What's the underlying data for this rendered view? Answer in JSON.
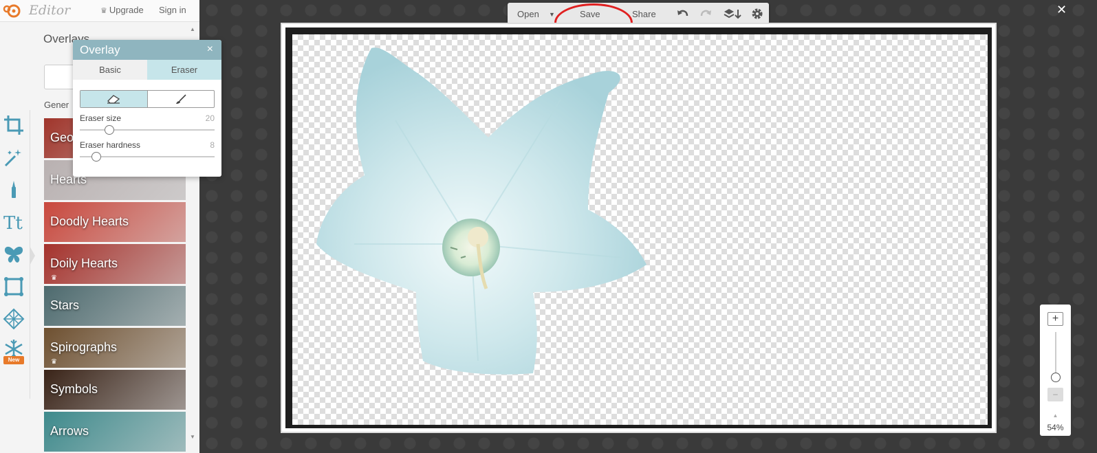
{
  "app": {
    "brand": "Editor",
    "upgrade_label": "Upgrade",
    "signin_label": "Sign in",
    "close_label": "✕"
  },
  "sidebar": {
    "panel_title": "Overlays",
    "generic_tab": "Gener",
    "categories": [
      {
        "label": "Geo",
        "premium": false,
        "color": "#a0352b"
      },
      {
        "label": "Hearts",
        "premium": false,
        "color": "#b9b1b1"
      },
      {
        "label": "Doodly Hearts",
        "premium": false,
        "color": "#c9483d"
      },
      {
        "label": "Doily Hearts",
        "premium": true,
        "color": "#a5322c"
      },
      {
        "label": "Stars",
        "premium": false,
        "color": "#4d6a6e"
      },
      {
        "label": "Spirographs",
        "premium": true,
        "color": "#6e5030"
      },
      {
        "label": "Symbols",
        "premium": false,
        "color": "#3a2418"
      },
      {
        "label": "Arrows",
        "premium": false,
        "color": "#3e8a8c"
      }
    ],
    "new_badge": "New"
  },
  "overlay_panel": {
    "title": "Overlay",
    "close_label": "×",
    "tabs": [
      {
        "label": "Basic",
        "active": false
      },
      {
        "label": "Eraser",
        "active": true
      }
    ],
    "eraser_size": {
      "label": "Eraser size",
      "value": "20",
      "fraction": 0.22
    },
    "eraser_hardness": {
      "label": "Eraser hardness",
      "value": "8",
      "fraction": 0.12
    }
  },
  "toolbar": {
    "open_label": "Open",
    "save_label": "Save",
    "share_label": "Share"
  },
  "zoom": {
    "plus_label": "+",
    "minus_label": "–",
    "value": "54%",
    "fraction": 0.54
  },
  "colors": {
    "accent": "#8fb5bf",
    "active_tab": "#c6e5ea",
    "highlight": "#e02020",
    "rail_icon": "#4a9ab5"
  }
}
